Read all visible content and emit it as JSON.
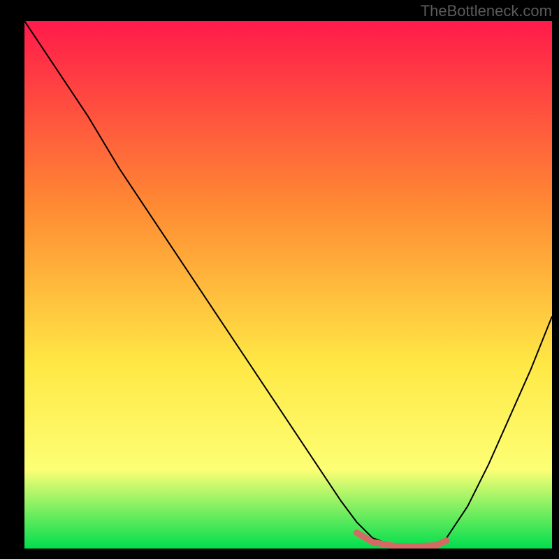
{
  "watermark": "TheBottleneck.com",
  "chart_data": {
    "type": "line",
    "title": "",
    "xlabel": "",
    "ylabel": "",
    "xlim": [
      0,
      100
    ],
    "ylim": [
      0,
      100
    ],
    "grid": false,
    "legend": false,
    "background_gradient": {
      "top": "#ff1a4a",
      "mid_upper": "#ff8a33",
      "mid": "#ffe845",
      "mid_lower": "#fdff75",
      "bottom": "#00de4e"
    },
    "series": [
      {
        "name": "bottleneck-curve",
        "color": "#000000",
        "stroke_width": 2,
        "x": [
          0,
          6,
          12,
          18,
          24,
          30,
          36,
          42,
          48,
          54,
          60,
          63,
          66,
          70,
          74,
          78,
          80,
          84,
          88,
          92,
          96,
          100
        ],
        "values": [
          100,
          91,
          82,
          72,
          63,
          54,
          45,
          36,
          27,
          18,
          9,
          5,
          2,
          0.5,
          0.3,
          0.5,
          2,
          8,
          16,
          25,
          34,
          44
        ]
      },
      {
        "name": "optimal-region-highlight",
        "color": "#d46a64",
        "stroke_width": 9,
        "x": [
          63,
          66,
          70,
          74,
          78,
          80
        ],
        "values": [
          3,
          1.2,
          0.5,
          0.4,
          0.6,
          1.5
        ]
      }
    ]
  }
}
